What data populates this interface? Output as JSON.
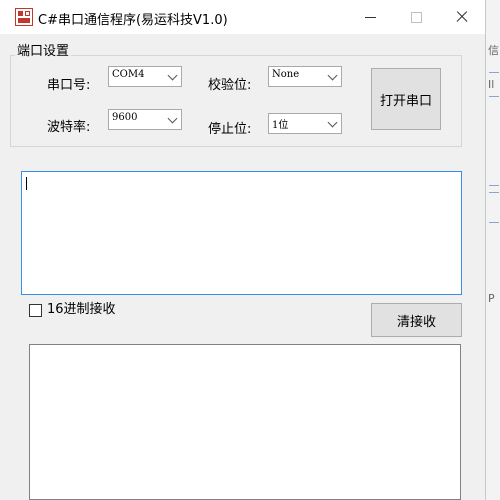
{
  "window": {
    "title": "C#串口通信程序(易运科技V1.0)"
  },
  "port_settings": {
    "group_title": "端口设置",
    "port_label": "串口号:",
    "port_value": "COM4",
    "parity_label": "校验位:",
    "parity_value": "None",
    "baud_label": "波特率:",
    "baud_value": "9600",
    "stopbits_label": "停止位:",
    "stopbits_value": "1位",
    "open_button": "打开串口"
  },
  "receive": {
    "hex_checkbox_label": "16进制接收",
    "hex_checked": false,
    "clear_button": "清接收"
  },
  "background_window": {
    "edge_chars": [
      "信",
      "Il",
      "",
      "P"
    ]
  },
  "colors": {
    "focus_border": "#3a8ee6",
    "window_bg": "#f0f0f0"
  }
}
